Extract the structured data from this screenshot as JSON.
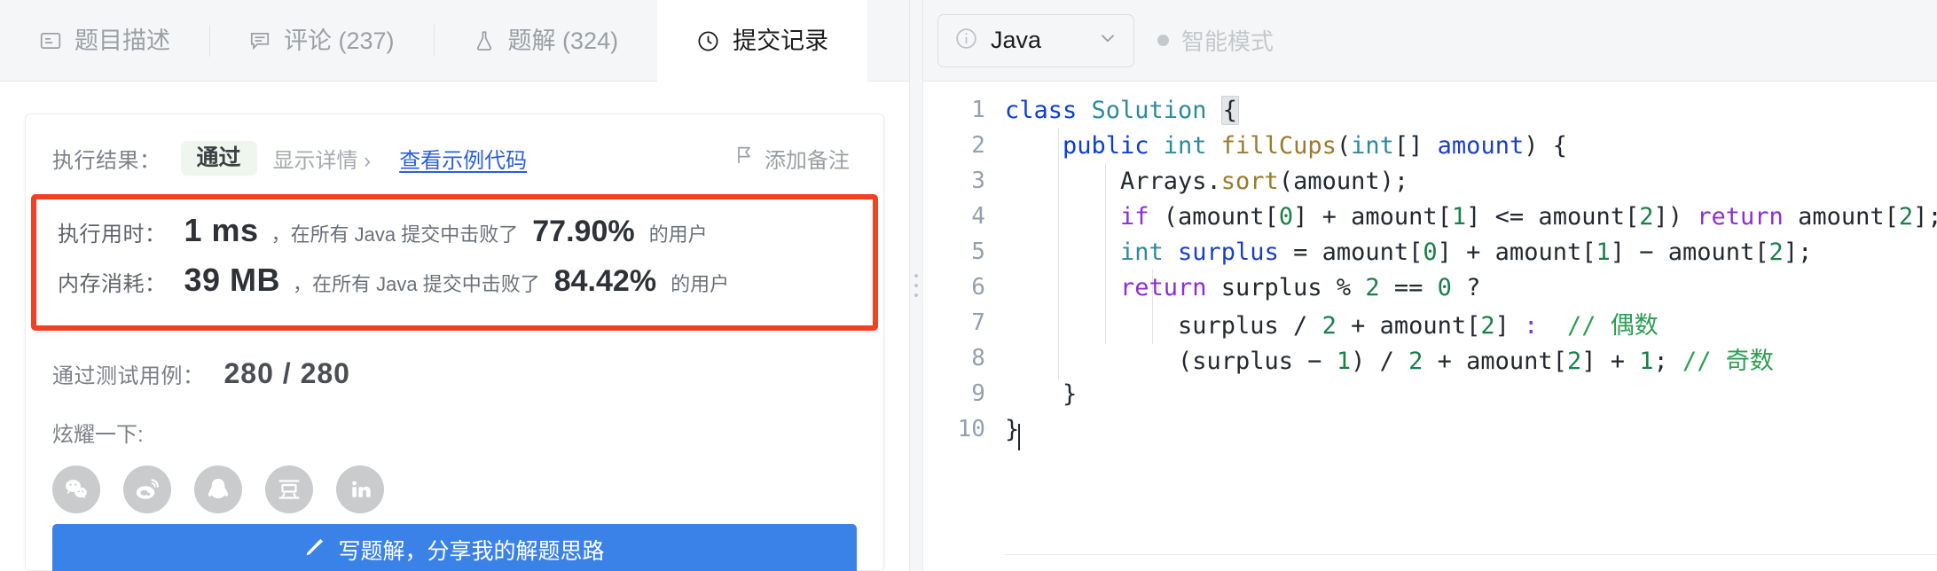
{
  "tabs": [
    {
      "label": "题目描述",
      "icon": "description-icon",
      "active": false
    },
    {
      "label": "评论 (237)",
      "icon": "comment-icon",
      "active": false
    },
    {
      "label": "题解 (324)",
      "icon": "flask-icon",
      "active": false
    },
    {
      "label": "提交记录",
      "icon": "clock-icon",
      "active": true
    }
  ],
  "result": {
    "label": "执行结果：",
    "status": "通过",
    "details_link": "显示详情 ›",
    "sample_code_link": "查看示例代码",
    "add_note": "添加备注",
    "add_note_icon": "flag-icon"
  },
  "stats": {
    "runtime": {
      "label": "执行用时：",
      "value": "1 ms",
      "mid": "，在所有 Java 提交中击败了",
      "percent": "77.90%",
      "tail": "的用户"
    },
    "memory": {
      "label": "内存消耗：",
      "value": "39 MB",
      "mid": "，在所有 Java 提交中击败了",
      "percent": "84.42%",
      "tail": "的用户"
    },
    "highlight_color": "#f04123"
  },
  "testcases": {
    "label": "通过测试用例：",
    "value": "280 / 280"
  },
  "share": {
    "label": "炫耀一下:",
    "icons": [
      {
        "name": "wechat-icon"
      },
      {
        "name": "weibo-icon"
      },
      {
        "name": "qq-icon"
      },
      {
        "name": "douban-icon"
      },
      {
        "name": "linkedin-icon"
      }
    ]
  },
  "cta": {
    "label": "写题解，分享我的解题思路",
    "icon": "pencil-icon",
    "color": "#3b82e8"
  },
  "editor": {
    "language": "Java",
    "language_icon": "info-icon",
    "chevron_icon": "chevron-down-icon",
    "smart_mode": "智能模式",
    "lines": [
      {
        "n": "1",
        "tokens": [
          {
            "t": "class ",
            "c": "kw-blue"
          },
          {
            "t": "Solution ",
            "c": "cls"
          },
          {
            "t": "{",
            "c": "brace-hl"
          }
        ]
      },
      {
        "n": "2",
        "tokens": [
          {
            "t": "    ",
            "c": "punct"
          },
          {
            "t": "public ",
            "c": "kw-blue"
          },
          {
            "t": "int ",
            "c": "type"
          },
          {
            "t": "fillCups",
            "c": "fn"
          },
          {
            "t": "(",
            "c": "punct"
          },
          {
            "t": "int",
            "c": "type"
          },
          {
            "t": "[] ",
            "c": "punct"
          },
          {
            "t": "amount",
            "c": "var"
          },
          {
            "t": ") {",
            "c": "punct"
          }
        ]
      },
      {
        "n": "3",
        "tokens": [
          {
            "t": "        Arrays",
            "c": "punct"
          },
          {
            "t": ".",
            "c": "punct"
          },
          {
            "t": "sort",
            "c": "fn"
          },
          {
            "t": "(amount);",
            "c": "punct"
          }
        ]
      },
      {
        "n": "4",
        "tokens": [
          {
            "t": "        ",
            "c": "punct"
          },
          {
            "t": "if",
            "c": "op-pur"
          },
          {
            "t": " (amount[",
            "c": "punct"
          },
          {
            "t": "0",
            "c": "num"
          },
          {
            "t": "] + amount[",
            "c": "punct"
          },
          {
            "t": "1",
            "c": "num"
          },
          {
            "t": "] <= amount[",
            "c": "punct"
          },
          {
            "t": "2",
            "c": "num"
          },
          {
            "t": "]) ",
            "c": "punct"
          },
          {
            "t": "return",
            "c": "op-pur"
          },
          {
            "t": " amount[",
            "c": "punct"
          },
          {
            "t": "2",
            "c": "num"
          },
          {
            "t": "];",
            "c": "punct"
          }
        ]
      },
      {
        "n": "5",
        "tokens": [
          {
            "t": "        ",
            "c": "punct"
          },
          {
            "t": "int",
            "c": "type"
          },
          {
            "t": " ",
            "c": "punct"
          },
          {
            "t": "surplus",
            "c": "var"
          },
          {
            "t": " = amount[",
            "c": "punct"
          },
          {
            "t": "0",
            "c": "num"
          },
          {
            "t": "] + amount[",
            "c": "punct"
          },
          {
            "t": "1",
            "c": "num"
          },
          {
            "t": "] − amount[",
            "c": "punct"
          },
          {
            "t": "2",
            "c": "num"
          },
          {
            "t": "];",
            "c": "punct"
          }
        ]
      },
      {
        "n": "6",
        "tokens": [
          {
            "t": "        ",
            "c": "punct"
          },
          {
            "t": "return",
            "c": "op-pur"
          },
          {
            "t": " surplus % ",
            "c": "punct"
          },
          {
            "t": "2",
            "c": "num"
          },
          {
            "t": " == ",
            "c": "punct"
          },
          {
            "t": "0",
            "c": "num"
          },
          {
            "t": " ?",
            "c": "punct"
          }
        ]
      },
      {
        "n": "7",
        "tokens": [
          {
            "t": "            surplus / ",
            "c": "punct"
          },
          {
            "t": "2",
            "c": "num"
          },
          {
            "t": " + amount[",
            "c": "punct"
          },
          {
            "t": "2",
            "c": "num"
          },
          {
            "t": "] ",
            "c": "punct"
          },
          {
            "t": ":",
            "c": "op-pur"
          },
          {
            "t": "  ",
            "c": "punct"
          },
          {
            "t": "// 偶数",
            "c": "cmt"
          }
        ]
      },
      {
        "n": "8",
        "tokens": [
          {
            "t": "            (surplus − ",
            "c": "punct"
          },
          {
            "t": "1",
            "c": "num"
          },
          {
            "t": ") / ",
            "c": "punct"
          },
          {
            "t": "2",
            "c": "num"
          },
          {
            "t": " + amount[",
            "c": "punct"
          },
          {
            "t": "2",
            "c": "num"
          },
          {
            "t": "] + ",
            "c": "punct"
          },
          {
            "t": "1",
            "c": "num"
          },
          {
            "t": "; ",
            "c": "punct"
          },
          {
            "t": "// 奇数",
            "c": "cmt"
          }
        ]
      },
      {
        "n": "9",
        "tokens": [
          {
            "t": "    }",
            "c": "punct"
          }
        ]
      },
      {
        "n": "10",
        "tokens": [
          {
            "t": "}",
            "c": "punct"
          }
        ]
      }
    ]
  }
}
